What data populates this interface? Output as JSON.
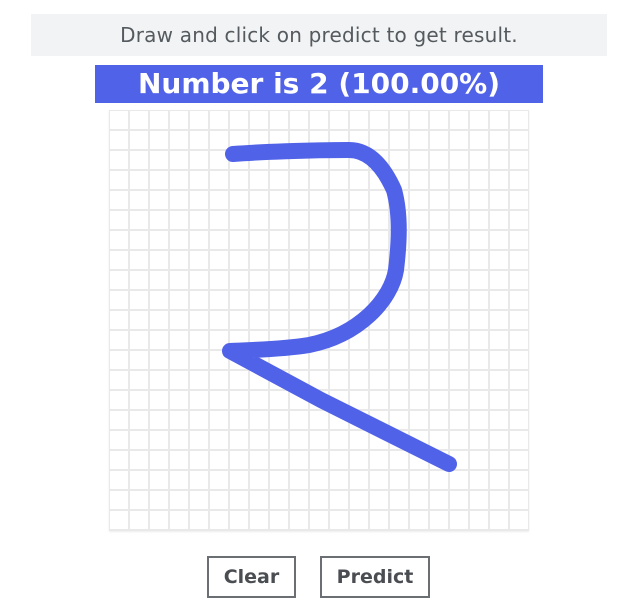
{
  "instruction": {
    "text": "Draw and click on predict to get result."
  },
  "result": {
    "text": "Number is 2 (100.00%)"
  },
  "drawing_canvas": {
    "grid": true
  },
  "buttons": {
    "clear_label": "Clear",
    "predict_label": "Predict"
  },
  "colors": {
    "accent": "#5062e8",
    "instruction_bg": "#f2f3f4",
    "grid_line": "#e9e9e9",
    "button_border": "#6b6e72"
  }
}
